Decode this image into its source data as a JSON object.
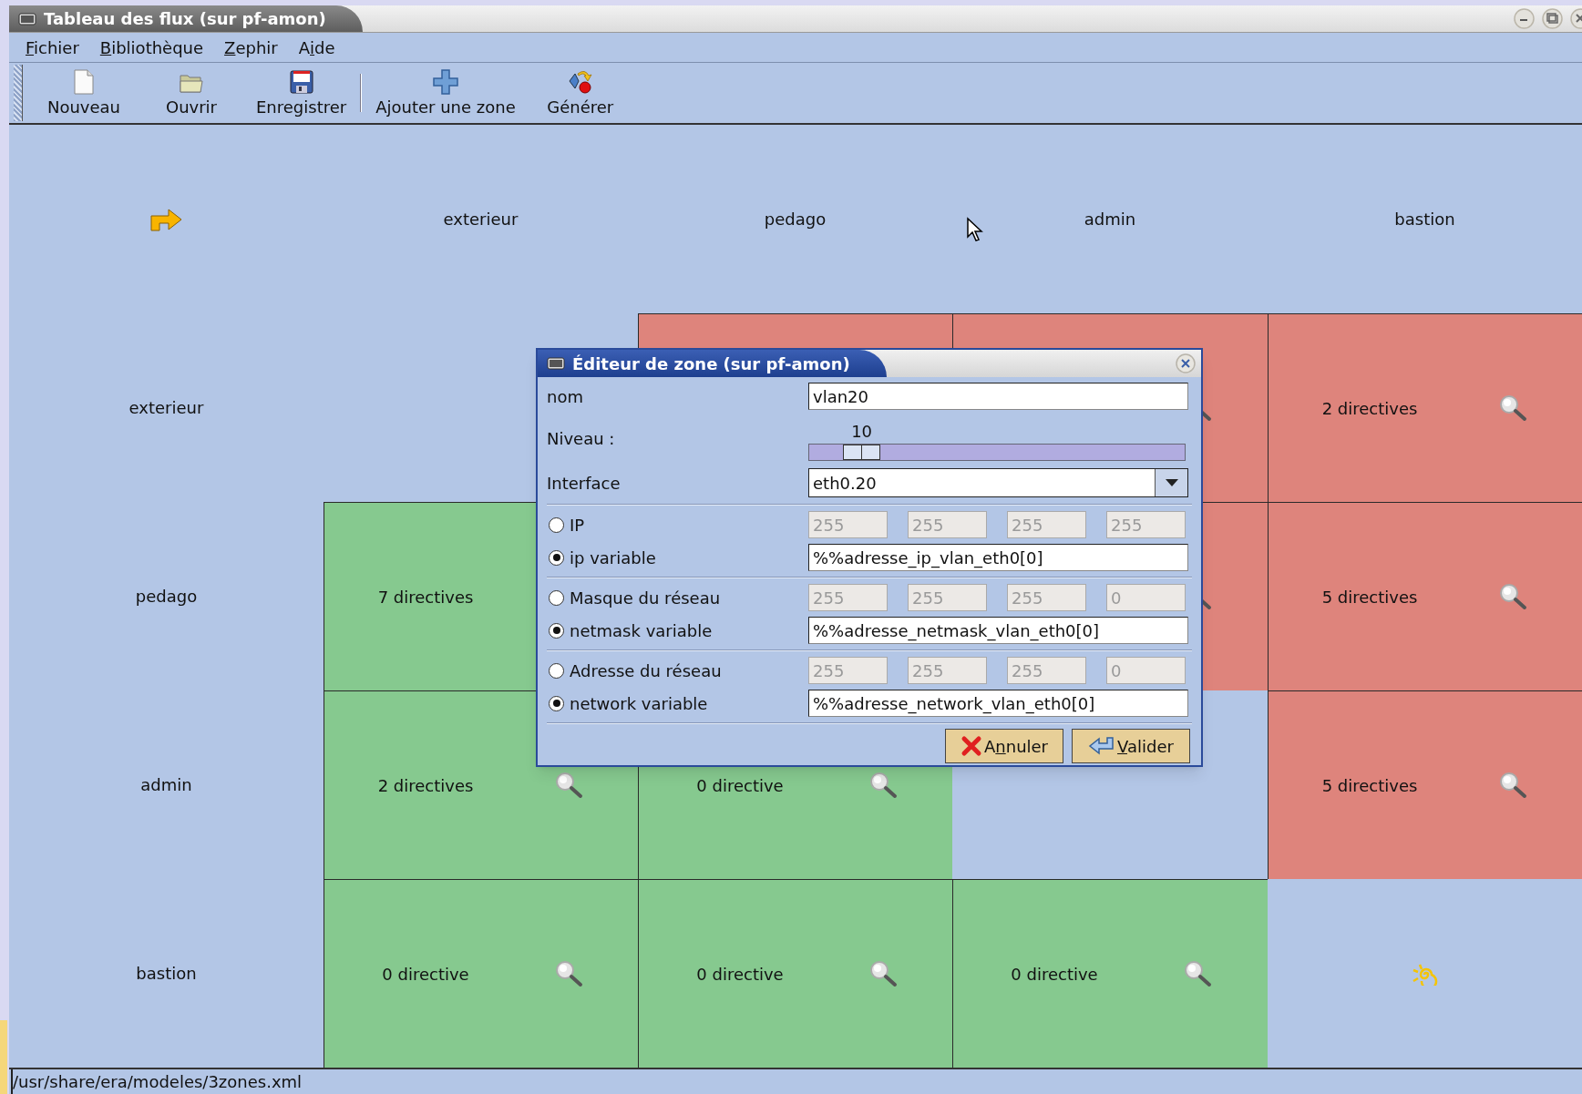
{
  "window": {
    "title": "Tableau des flux (sur pf-amon)"
  },
  "menu": [
    {
      "key": "F",
      "after": "ichier"
    },
    {
      "key": "B",
      "after": "ibliothèque"
    },
    {
      "key": "Z",
      "after": "ephir"
    },
    {
      "before": "A",
      "key": "i",
      "after": "de"
    }
  ],
  "toolbar": [
    [
      {
        "kind": "new",
        "label": "Nouveau"
      },
      {
        "kind": "open",
        "label": "Ouvrir"
      },
      {
        "kind": "save",
        "label": "Enregistrer"
      }
    ],
    [
      {
        "kind": "add",
        "label": "Ajouter une zone"
      },
      {
        "kind": "generate",
        "label": "Générer"
      }
    ]
  ],
  "matrix": {
    "columns": [
      "exterieur",
      "pedago",
      "admin",
      "bastion"
    ],
    "rows": [
      {
        "label": "exterieur",
        "cells": [
          {
            "kind": "self"
          },
          {
            "kind": "deny"
          },
          {
            "kind": "deny",
            "search": true
          },
          {
            "kind": "deny",
            "text": "2 directives",
            "search": true
          }
        ]
      },
      {
        "label": "pedago",
        "cells": [
          {
            "kind": "allow",
            "text": "7 directives"
          },
          {
            "kind": "self"
          },
          {
            "kind": "deny",
            "search": true
          },
          {
            "kind": "deny",
            "text": "5 directives",
            "search": true
          }
        ]
      },
      {
        "label": "admin",
        "cells": [
          {
            "kind": "allow",
            "text": "2 directives",
            "search": true
          },
          {
            "kind": "allow",
            "text": "0 directive",
            "search": true
          },
          {
            "kind": "self"
          },
          {
            "kind": "deny",
            "text": "5 directives",
            "search": true
          }
        ]
      },
      {
        "label": "bastion",
        "cells": [
          {
            "kind": "allow",
            "text": "0 directive",
            "search": true
          },
          {
            "kind": "allow",
            "text": "0 directive",
            "search": true
          },
          {
            "kind": "allow",
            "text": "0 directive",
            "search": true
          },
          {
            "kind": "home"
          }
        ]
      }
    ]
  },
  "dialog": {
    "title": "Éditeur de zone (sur pf-amon)",
    "name": {
      "label": "nom",
      "value": "vlan20"
    },
    "level": {
      "label": "Niveau :",
      "reading": "10",
      "level": 0.1
    },
    "interface": {
      "label": "Interface",
      "value": "eth0.20"
    },
    "groups": [
      [
        {
          "kind": "octets",
          "label": "IP",
          "selected": false,
          "octets": [
            "255",
            "255",
            "255",
            "255"
          ]
        },
        {
          "kind": "text",
          "label": "ip variable",
          "selected": true,
          "value": "%%adresse_ip_vlan_eth0[0]"
        }
      ],
      [
        {
          "kind": "octets",
          "label": "Masque du réseau",
          "selected": false,
          "octets": [
            "255",
            "255",
            "255",
            "0"
          ]
        },
        {
          "kind": "text",
          "label": "netmask variable",
          "selected": true,
          "value": "%%adresse_netmask_vlan_eth0[0]"
        }
      ],
      [
        {
          "kind": "octets",
          "label": "Adresse du réseau",
          "selected": false,
          "octets": [
            "255",
            "255",
            "255",
            "0"
          ]
        },
        {
          "kind": "text",
          "label": "network variable",
          "selected": true,
          "value": "%%adresse_network_vlan_eth0[0]"
        }
      ]
    ],
    "buttons": [
      {
        "kind": "cancel",
        "before": "A",
        "key": "n",
        "after": "nuler"
      },
      {
        "kind": "ok",
        "key": "V",
        "after": "alider"
      }
    ]
  },
  "status_bar": "/usr/share/era/modeles/3zones.xml"
}
